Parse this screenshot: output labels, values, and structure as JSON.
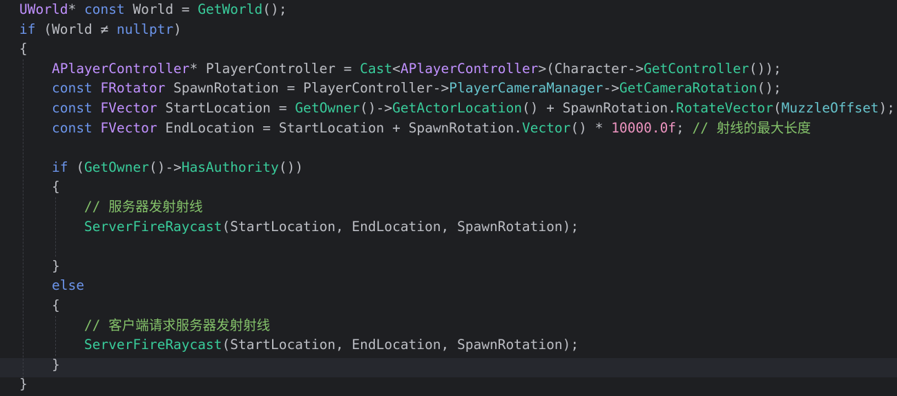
{
  "editor": {
    "theme": {
      "background": "#1e1f22",
      "current_line": "#26282e",
      "default_text": "#bcbec4"
    },
    "lines": [
      [
        {
          "t": "UWorld",
          "c": "#c191ff"
        },
        {
          "t": "* ",
          "c": "#bcbec4"
        },
        {
          "t": "const",
          "c": "#6c95eb"
        },
        {
          "t": " ",
          "c": "#bcbec4"
        },
        {
          "t": "World",
          "c": "#bcbec4"
        },
        {
          "t": " = ",
          "c": "#bcbec4"
        },
        {
          "t": "GetWorld",
          "c": "#39cc9b"
        },
        {
          "t": "();",
          "c": "#bcbec4"
        }
      ],
      [
        {
          "t": "if",
          "c": "#6c95eb"
        },
        {
          "t": " (",
          "c": "#bcbec4"
        },
        {
          "t": "World",
          "c": "#bcbec4"
        },
        {
          "t": " ≠ ",
          "c": "#bcbec4"
        },
        {
          "t": "nullptr",
          "c": "#6c95eb"
        },
        {
          "t": ")",
          "c": "#bcbec4"
        }
      ],
      [
        {
          "t": "{",
          "c": "#bcbec4"
        }
      ],
      [
        {
          "t": "    ",
          "c": "#bcbec4"
        },
        {
          "t": "APlayerController",
          "c": "#c191ff"
        },
        {
          "t": "* ",
          "c": "#bcbec4"
        },
        {
          "t": "PlayerController",
          "c": "#bcbec4"
        },
        {
          "t": " = ",
          "c": "#bcbec4"
        },
        {
          "t": "Cast",
          "c": "#39cc9b"
        },
        {
          "t": "<",
          "c": "#bcbec4"
        },
        {
          "t": "APlayerController",
          "c": "#c191ff"
        },
        {
          "t": ">(",
          "c": "#bcbec4"
        },
        {
          "t": "Character",
          "c": "#bcbec4"
        },
        {
          "t": "->",
          "c": "#bcbec4"
        },
        {
          "t": "GetController",
          "c": "#39cc9b"
        },
        {
          "t": "());",
          "c": "#bcbec4"
        }
      ],
      [
        {
          "t": "    ",
          "c": "#bcbec4"
        },
        {
          "t": "const",
          "c": "#6c95eb"
        },
        {
          "t": " ",
          "c": "#bcbec4"
        },
        {
          "t": "FRotator",
          "c": "#c191ff"
        },
        {
          "t": " ",
          "c": "#bcbec4"
        },
        {
          "t": "SpawnRotation",
          "c": "#bcbec4"
        },
        {
          "t": " = ",
          "c": "#bcbec4"
        },
        {
          "t": "PlayerController",
          "c": "#bcbec4"
        },
        {
          "t": "->",
          "c": "#bcbec4"
        },
        {
          "t": "PlayerCameraManager",
          "c": "#66c3cc"
        },
        {
          "t": "->",
          "c": "#bcbec4"
        },
        {
          "t": "GetCameraRotation",
          "c": "#39cc9b"
        },
        {
          "t": "();",
          "c": "#bcbec4"
        }
      ],
      [
        {
          "t": "    ",
          "c": "#bcbec4"
        },
        {
          "t": "const",
          "c": "#6c95eb"
        },
        {
          "t": " ",
          "c": "#bcbec4"
        },
        {
          "t": "FVector",
          "c": "#c191ff"
        },
        {
          "t": " ",
          "c": "#bcbec4"
        },
        {
          "t": "StartLocation",
          "c": "#bcbec4"
        },
        {
          "t": " = ",
          "c": "#bcbec4"
        },
        {
          "t": "GetOwner",
          "c": "#39cc9b"
        },
        {
          "t": "()->",
          "c": "#bcbec4"
        },
        {
          "t": "GetActorLocation",
          "c": "#39cc9b"
        },
        {
          "t": "() + ",
          "c": "#bcbec4"
        },
        {
          "t": "SpawnRotation",
          "c": "#bcbec4"
        },
        {
          "t": ".",
          "c": "#bcbec4"
        },
        {
          "t": "RotateVector",
          "c": "#39cc9b"
        },
        {
          "t": "(",
          "c": "#bcbec4"
        },
        {
          "t": "MuzzleOffset",
          "c": "#66c3cc"
        },
        {
          "t": ");",
          "c": "#bcbec4"
        }
      ],
      [
        {
          "t": "    ",
          "c": "#bcbec4"
        },
        {
          "t": "const",
          "c": "#6c95eb"
        },
        {
          "t": " ",
          "c": "#bcbec4"
        },
        {
          "t": "FVector",
          "c": "#c191ff"
        },
        {
          "t": " ",
          "c": "#bcbec4"
        },
        {
          "t": "EndLocation",
          "c": "#bcbec4"
        },
        {
          "t": " = ",
          "c": "#bcbec4"
        },
        {
          "t": "StartLocation",
          "c": "#bcbec4"
        },
        {
          "t": " + ",
          "c": "#bcbec4"
        },
        {
          "t": "SpawnRotation",
          "c": "#bcbec4"
        },
        {
          "t": ".",
          "c": "#bcbec4"
        },
        {
          "t": "Vector",
          "c": "#39cc9b"
        },
        {
          "t": "() * ",
          "c": "#bcbec4"
        },
        {
          "t": "10000.0f",
          "c": "#ed94c0"
        },
        {
          "t": "; ",
          "c": "#bcbec4"
        },
        {
          "t": "// 射线的最大长度",
          "c": "#84c26a"
        }
      ],
      [],
      [
        {
          "t": "    ",
          "c": "#bcbec4"
        },
        {
          "t": "if",
          "c": "#6c95eb"
        },
        {
          "t": " (",
          "c": "#bcbec4"
        },
        {
          "t": "GetOwner",
          "c": "#39cc9b"
        },
        {
          "t": "()->",
          "c": "#bcbec4"
        },
        {
          "t": "HasAuthority",
          "c": "#39cc9b"
        },
        {
          "t": "())",
          "c": "#bcbec4"
        }
      ],
      [
        {
          "t": "    {",
          "c": "#bcbec4"
        }
      ],
      [
        {
          "t": "        ",
          "c": "#bcbec4"
        },
        {
          "t": "// 服务器发射射线",
          "c": "#84c26a"
        }
      ],
      [
        {
          "t": "        ",
          "c": "#bcbec4"
        },
        {
          "t": "ServerFireRaycast",
          "c": "#39cc9b"
        },
        {
          "t": "(",
          "c": "#bcbec4"
        },
        {
          "t": "StartLocation",
          "c": "#bcbec4"
        },
        {
          "t": ", ",
          "c": "#bcbec4"
        },
        {
          "t": "EndLocation",
          "c": "#bcbec4"
        },
        {
          "t": ", ",
          "c": "#bcbec4"
        },
        {
          "t": "SpawnRotation",
          "c": "#bcbec4"
        },
        {
          "t": ");",
          "c": "#bcbec4"
        }
      ],
      [],
      [
        {
          "t": "    }",
          "c": "#bcbec4"
        }
      ],
      [
        {
          "t": "    ",
          "c": "#bcbec4"
        },
        {
          "t": "else",
          "c": "#6c95eb"
        }
      ],
      [
        {
          "t": "    {",
          "c": "#bcbec4"
        }
      ],
      [
        {
          "t": "        ",
          "c": "#bcbec4"
        },
        {
          "t": "// 客户端请求服务器发射射线",
          "c": "#84c26a"
        }
      ],
      [
        {
          "t": "        ",
          "c": "#bcbec4"
        },
        {
          "t": "ServerFireRaycast",
          "c": "#39cc9b"
        },
        {
          "t": "(",
          "c": "#bcbec4"
        },
        {
          "t": "StartLocation",
          "c": "#bcbec4"
        },
        {
          "t": ", ",
          "c": "#bcbec4"
        },
        {
          "t": "EndLocation",
          "c": "#bcbec4"
        },
        {
          "t": ", ",
          "c": "#bcbec4"
        },
        {
          "t": "SpawnRotation",
          "c": "#bcbec4"
        },
        {
          "t": ");",
          "c": "#bcbec4"
        }
      ],
      [
        {
          "t": "    }",
          "c": "#bcbec4"
        }
      ],
      [
        {
          "t": "}",
          "c": "#bcbec4"
        }
      ]
    ]
  }
}
